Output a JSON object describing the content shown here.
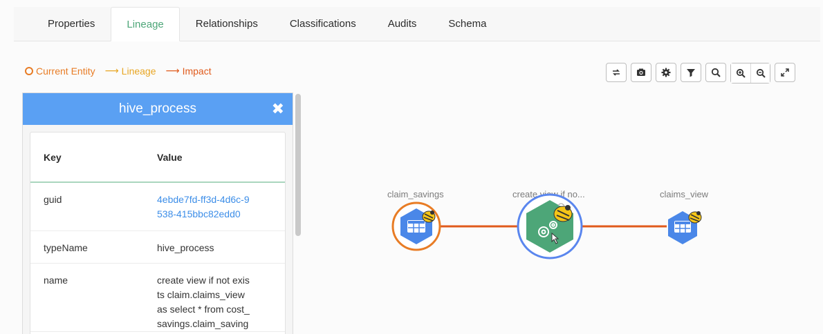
{
  "tabs": [
    {
      "label": "Properties"
    },
    {
      "label": "Lineage"
    },
    {
      "label": "Relationships"
    },
    {
      "label": "Classifications"
    },
    {
      "label": "Audits"
    },
    {
      "label": "Schema"
    }
  ],
  "active_tab": "Lineage",
  "legend": {
    "current_entity": "Current Entity",
    "lineage": "Lineage",
    "impact": "Impact",
    "colors": {
      "current_entity": "#e87c25",
      "lineage": "#e8a623",
      "impact": "#e05a1b"
    }
  },
  "toolbar": {
    "buttons": [
      "refresh-icon",
      "camera-icon",
      "gear-icon",
      "filter-icon",
      "search-icon",
      "zoom-in-icon",
      "zoom-out-icon",
      "fullscreen-icon"
    ]
  },
  "panel": {
    "title": "hive_process",
    "header_color": "#5aa0f3",
    "table": {
      "key_header": "Key",
      "value_header": "Value",
      "rows": [
        {
          "key": "guid",
          "value": "4ebde7fd-ff3d-4d6c-9538-415bbc82edd0",
          "value_lines": [
            "4ebde7fd-ff3d-4d6c-9",
            "538-415bbc82edd0"
          ]
        },
        {
          "key": "typeName",
          "value": "hive_process"
        },
        {
          "key": "name",
          "value": "create view if not exists claim.claims_view as select * from cost_savings.claim_saving",
          "value_lines": [
            "create view if not exis",
            "ts claim.claims_view",
            "as select * from cost_",
            "savings.claim_saving"
          ]
        }
      ]
    }
  },
  "graph": {
    "nodes": [
      {
        "label": "claim_savings",
        "kind": "table",
        "current": true
      },
      {
        "label": "create view if no...",
        "kind": "process",
        "selected": true
      },
      {
        "label": "claims_view",
        "kind": "table"
      }
    ],
    "edge_color": "#e05a1b",
    "table_node_color": "#4a87e8",
    "process_node_color": "#4da678"
  }
}
